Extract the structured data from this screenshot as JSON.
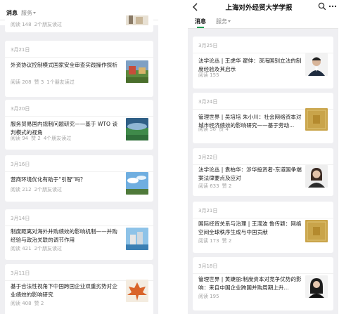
{
  "left": {
    "tabs": [
      {
        "label": "消息",
        "active": true
      },
      {
        "label": "服务",
        "active": false
      }
    ],
    "top_card": {
      "meta": [
        "阅读 148",
        "2个朋友读过"
      ]
    },
    "cards": [
      {
        "date": "3月21日",
        "title": "外资协议控制模式国家安全审查实践操作探析",
        "meta": [
          "阅读 208",
          "赞 3",
          "1个朋友读过"
        ],
        "thumb": "landscape"
      },
      {
        "date": "3月20日",
        "title": "服务贸易国内规制问题研究——基于 WTO 谈判模式的视角",
        "meta": [
          "阅读 94",
          "赞 2",
          "4个朋友读过"
        ],
        "thumb": "stadium"
      },
      {
        "date": "3月16日",
        "title": "营商环境优化有助于“引智”吗？",
        "meta": [
          "阅读 212",
          "2个朋友读过"
        ],
        "thumb": "sky"
      },
      {
        "date": "3月14日",
        "title": "制度距离对海外并购绩效的影响机制——并购经验与政治关联的调节作用",
        "meta": [
          "阅读 421",
          "2个朋友读过"
        ],
        "thumb": "waterfront"
      },
      {
        "date": "3月11日",
        "title": "基于合法性视角下中国跨国企业双重劣势对企业绩效的影响研究",
        "meta": [
          "阅读 408",
          "赞 2"
        ],
        "thumb": "maple"
      }
    ]
  },
  "right": {
    "nav_title": "上海对外经贸大学学报",
    "icons": {
      "back": "back-icon",
      "search": "search-icon",
      "more": "more-icon"
    },
    "tabs": [
      {
        "label": "消息",
        "active": true
      },
      {
        "label": "服务",
        "active": false
      }
    ],
    "cards": [
      {
        "date": "3月25日",
        "title": "法学论丛 | 王虎华 翟仲：深海国别立法的制度经验及其启示",
        "meta": [
          "阅读 155"
        ],
        "thumb": "portrait-man"
      },
      {
        "date": "3月24日",
        "title": "管理世界 | 吴培培 朱小川：社会网络资本对城市经济绩效的影响研究——基于劳动...",
        "meta": [
          "阅读 58",
          "赞 4"
        ],
        "thumb": "gold-cover"
      },
      {
        "date": "3月22日",
        "title": "法学论丛 | 袁柏华：涉华投资者-东道国争端案法律要点及应对",
        "meta": [
          "阅读 633",
          "赞 2"
        ],
        "thumb": "portrait-woman"
      },
      {
        "date": "3月21日",
        "title": "国际经贸关系与治理 | 王滢波 鲁传颖：网络空间全球秩序生成与中国贡献",
        "meta": [
          "阅读 173",
          "赞 2"
        ],
        "thumb": "gold-cover"
      },
      {
        "date": "3月18日",
        "title": "管理世界 | 黄婕丽:制度资本对竞争优势的影响：来自中国企业跨国并购周期上升...",
        "meta": [
          "阅读 195"
        ],
        "thumb": "portrait-woman-dark"
      }
    ]
  },
  "colors": {
    "accent": "#1f9d55",
    "meta": "#a4a4a4",
    "background": "#efeff2"
  }
}
